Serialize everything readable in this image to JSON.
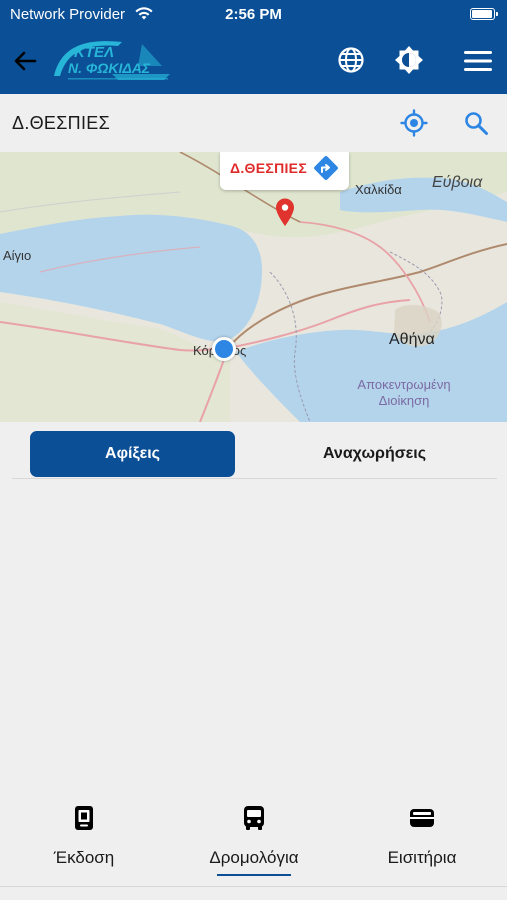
{
  "status_bar": {
    "carrier": "Network Provider",
    "time": "2:56 PM",
    "battery_level": 0.95
  },
  "app_bar": {
    "logo_line1": "ΚΤΕΛ",
    "logo_line2": "Ν. ΦΩΚΙΔΑΣ",
    "icons": [
      "back-arrow-icon",
      "ktel-logo",
      "globe-icon",
      "theme-icon",
      "menu-icon"
    ],
    "color": "#0b4f96"
  },
  "location_bar": {
    "name": "Δ.ΘΕΣΠΙΕΣ",
    "icons": [
      "my-location-icon",
      "search-icon"
    ],
    "accent": "#2d86e3"
  },
  "map": {
    "callout_label": "Δ.ΘΕΣΠΙΕΣ",
    "labels": {
      "chalkida": "Χαλκίδα",
      "evia": "Εύβοια",
      "aigio": "Αίγιο",
      "athina": "Αθήνα",
      "korinthos": "Κόρινθος",
      "autonomous_line1": "Αποκεντρωμένη",
      "autonomous_line2": "Διοίκηση"
    },
    "pin_color": "#e0332e",
    "user_location_color": "#2d86e3"
  },
  "tabs": {
    "arrivals": "Αφίξεις",
    "departures": "Αναχωρήσεις",
    "active": "arrivals"
  },
  "bottom_nav": {
    "issue": "Έκδοση",
    "routes": "Δρομολόγια",
    "tickets": "Εισιτήρια",
    "active": "routes"
  }
}
